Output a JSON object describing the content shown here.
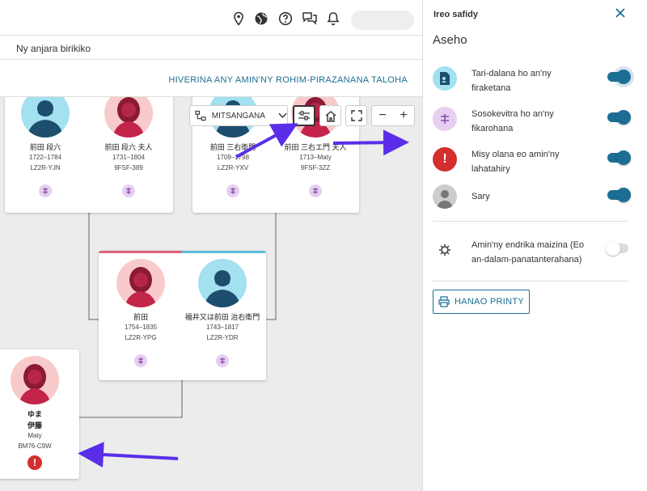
{
  "subnav": {
    "link": "Ny anjara birikiko"
  },
  "header": {
    "link": "HIVERINA ANY AMIN'NY ROHIM-PIRAZANANA TALOHA"
  },
  "toolbar": {
    "view_label": "MITSANGANA",
    "minus": "−",
    "plus": "+"
  },
  "persons": {
    "p1": {
      "name": "前田 段六",
      "dates": "1722–1784",
      "id": "LZ2R-YJN"
    },
    "p2": {
      "name": "前田 段六 夫人",
      "dates": "1731–1804",
      "id": "9FSF-389"
    },
    "p3": {
      "name": "前田 三右衛門",
      "dates": "1709–1798",
      "id": "LZ2R-YXV"
    },
    "p4": {
      "name": "前田 三右エ門 夫人",
      "dates": "1713–Maty",
      "id": "9FSF-3ZZ"
    },
    "p5": {
      "name": "前田",
      "dates": "1754–1835",
      "id": "LZ2R-YPG"
    },
    "p6": {
      "name": "福井又は前田 治右衛門",
      "dates": "1743–1817",
      "id": "LZ2R-YDR"
    },
    "p7": {
      "name1": "ゆま",
      "name2": "伊藤",
      "dates": "Maty",
      "id": "BM76-C9W"
    }
  },
  "panel": {
    "title": "Ireo safidy",
    "subtitle": "Aseho",
    "options": [
      {
        "label": "Tari-dalana ho an'ny firaketana",
        "on": true,
        "icon": "record-hints-icon"
      },
      {
        "label": "Sosokevitra ho an'ny fikarohana",
        "on": true,
        "icon": "research-suggestions-icon"
      },
      {
        "label": "Misy olana eo amin'ny lahatahiry",
        "on": true,
        "icon": "data-problem-icon"
      },
      {
        "label": "Sary",
        "on": true,
        "icon": "portrait-icon"
      }
    ],
    "high_contrast": {
      "label": "Amin'ny endrika maizina (Eo an-dalam-panatanterahana)",
      "on": false
    },
    "print_button": "HANAO PRINTY"
  },
  "colors": {
    "accent": "#1c6e94",
    "arrow": "#5a2ee8",
    "male": "#a3e0f0",
    "female": "#f9caca",
    "error": "#d32f2f"
  }
}
